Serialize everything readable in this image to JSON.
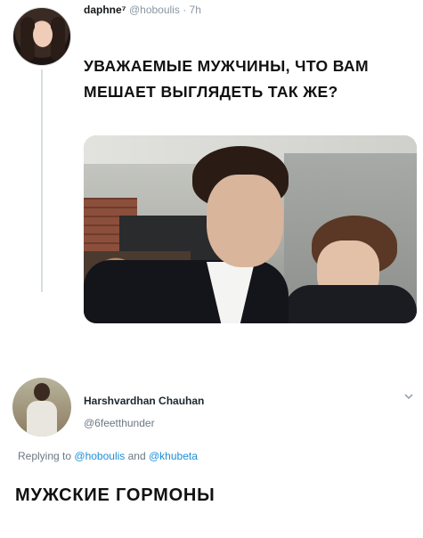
{
  "tweet": {
    "author_name": "daphne⁷",
    "author_handle": "@hoboulis",
    "separator": "·",
    "time": "7h",
    "text_line1": "Уважаемые мужчины, что вам",
    "text_line2": "мешает выглядеть так же?"
  },
  "reply": {
    "author_name": "Harshvardhan Chauhan",
    "author_handle": "@6feetthunder",
    "replying_prefix": "Replying to",
    "replying_user1": "@hoboulis",
    "replying_and": "and",
    "replying_user2": "@khubeta"
  },
  "caption": "Мужские гормоны",
  "colors": {
    "link": "#1a8fd8",
    "muted": "#8a96a1",
    "thread_line": "#d7dde2"
  }
}
